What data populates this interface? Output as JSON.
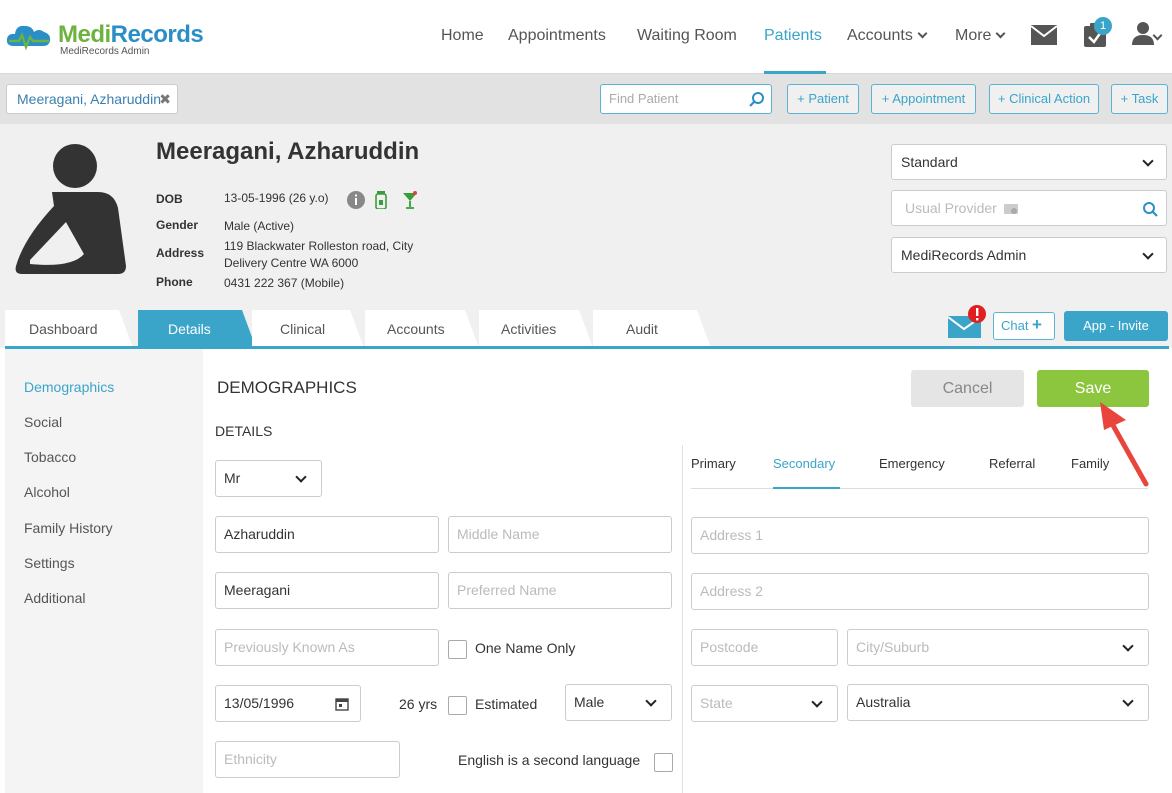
{
  "brand": {
    "name_part1": "Medi",
    "name_part2": "Records",
    "subtitle": "MediRecords Admin",
    "color_green": "#6cb33f",
    "color_blue": "#2a8fc7"
  },
  "nav": {
    "items": [
      "Home",
      "Appointments",
      "Waiting Room",
      "Patients",
      "Accounts",
      "More"
    ],
    "active": "Patients",
    "tasks_badge": "1",
    "accent": "#3ba4c9"
  },
  "toolbar": {
    "open_patient_tab": "Meeragani, Azharuddin",
    "find_placeholder": "Find Patient",
    "buttons": [
      "+ Patient",
      "+ Appointment",
      "+ Clinical Action",
      "+ Task"
    ]
  },
  "patient": {
    "name": "Meeragani, Azharuddin",
    "labels": {
      "dob": "DOB",
      "gender": "Gender",
      "address": "Address",
      "phone": "Phone"
    },
    "dob": "13-05-1996 (26 y.o)",
    "gender": "Male (Active)",
    "address_line1": "119 Blackwater Rolleston road, City",
    "address_line2": "Delivery Centre WA 6000",
    "phone": "0431 222 367 (Mobile)",
    "profile_select": "Standard",
    "usual_provider_placeholder": "Usual Provider",
    "practice_select": "MediRecords Admin"
  },
  "tabs": [
    "Dashboard",
    "Details",
    "Clinical",
    "Accounts",
    "Activities",
    "Audit"
  ],
  "active_tab": "Details",
  "actions": {
    "chat": "Chat",
    "invite": "App - Invite"
  },
  "sidebar": [
    "Demographics",
    "Social",
    "Tobacco",
    "Alcohol",
    "Family History",
    "Settings",
    "Additional"
  ],
  "form": {
    "section_title": "DEMOGRAPHICS",
    "subsection": "DETAILS",
    "cancel": "Cancel",
    "save": "Save",
    "title_value": "Mr",
    "first_name": "Azharuddin",
    "middle_name_placeholder": "Middle Name",
    "last_name": "Meeragani",
    "preferred_name_placeholder": "Preferred Name",
    "previously_known_placeholder": "Previously Known As",
    "one_name_only": "One Name Only",
    "dob_value": "13/05/1996",
    "age": "26 yrs",
    "estimated": "Estimated",
    "sex_value": "Male",
    "ethnicity_placeholder": "Ethnicity",
    "english_second": "English is a second language"
  },
  "address": {
    "tabs": [
      "Primary",
      "Secondary",
      "Emergency",
      "Referral",
      "Family"
    ],
    "active": "Secondary",
    "address1_placeholder": "Address 1",
    "address2_placeholder": "Address 2",
    "postcode_placeholder": "Postcode",
    "city_placeholder": "City/Suburb",
    "state_placeholder": "State",
    "country_value": "Australia"
  }
}
